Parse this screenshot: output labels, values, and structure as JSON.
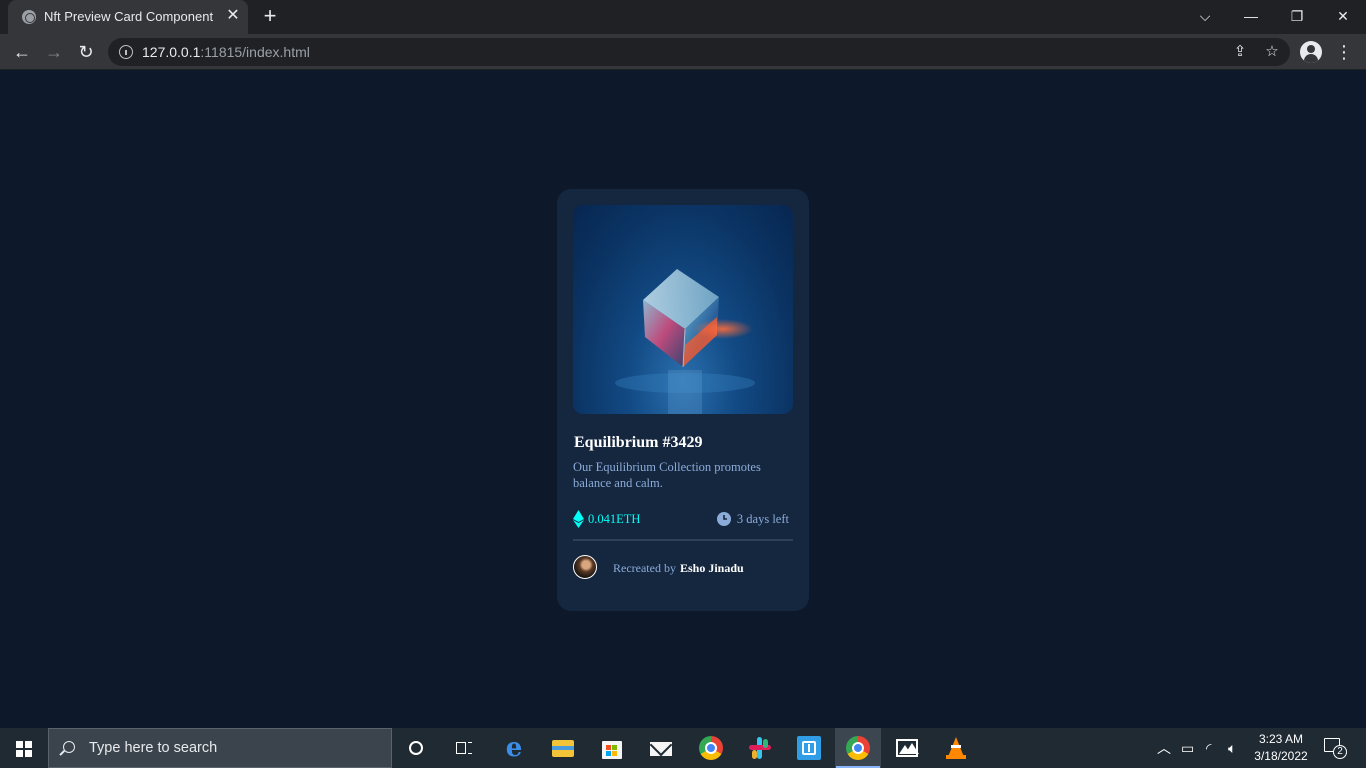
{
  "browser": {
    "tab_title": "Nft Preview Card Component",
    "url_host": "127.0.0.1",
    "url_rest": ":11815/index.html"
  },
  "card": {
    "title": "Equilibrium #3429",
    "description": "Our Equilibrium Collection promotes balance and calm.",
    "price": "0.041ETH",
    "time_left": "3 days left",
    "creator_prefix": "Recreated by",
    "creator_name": "Esho Jinadu",
    "colors": {
      "cyan": "#00fff7",
      "soft_blue": "#8bacd9",
      "card_bg": "#15263f",
      "page_bg": "#0d192b"
    }
  },
  "taskbar": {
    "search_placeholder": "Type here to search",
    "time": "3:23 AM",
    "date": "3/18/2022",
    "notification_count": "2",
    "pinned_icons": [
      "cortana-icon",
      "task-view-icon",
      "edge-icon",
      "file-explorer-icon",
      "store-icon",
      "mail-icon",
      "chrome-icon",
      "slack-icon",
      "remote-desktop-icon",
      "chrome-active-icon",
      "photos-icon",
      "vlc-icon"
    ]
  }
}
